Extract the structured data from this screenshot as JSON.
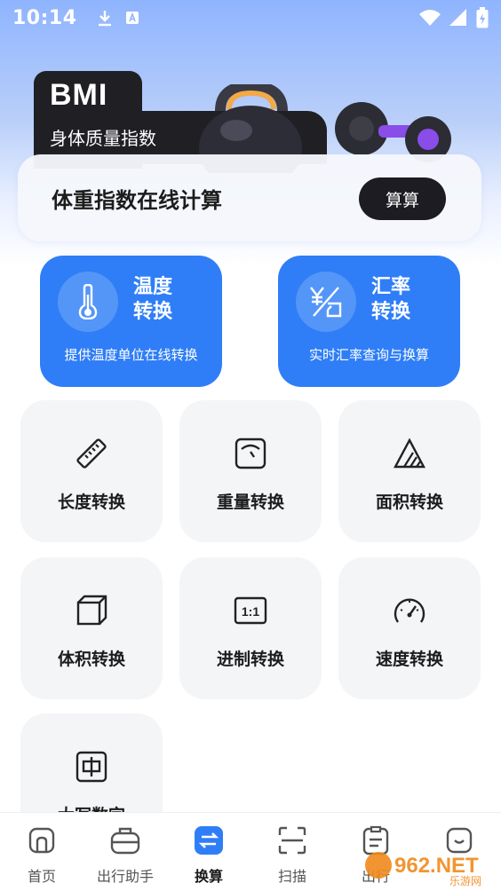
{
  "status_bar": {
    "time": "10:14"
  },
  "bmi": {
    "badge": "BMI",
    "subtitle": "身体质量指数",
    "panel_title": "体重指数在线计算",
    "calc_button": "算算"
  },
  "features": [
    {
      "title": "温度转换",
      "desc": "提供温度单位在线转换",
      "icon": "thermometer-icon"
    },
    {
      "title": "汇率转换",
      "desc": "实时汇率查询与换算",
      "icon": "currency-exchange-icon"
    }
  ],
  "tools": [
    {
      "label": "长度转换",
      "icon": "ruler-icon"
    },
    {
      "label": "重量转换",
      "icon": "scale-icon"
    },
    {
      "label": "面积转换",
      "icon": "area-icon"
    },
    {
      "label": "体积转换",
      "icon": "cube-icon"
    },
    {
      "label": "进制转换",
      "icon": "ratio-icon"
    },
    {
      "label": "速度转换",
      "icon": "speedometer-icon"
    },
    {
      "label": "大写数字",
      "icon": "chinese-numeral-icon"
    }
  ],
  "nav": [
    {
      "label": "首页",
      "icon": "home-icon"
    },
    {
      "label": "出行助手",
      "icon": "suitcase-icon"
    },
    {
      "label": "换算",
      "icon": "swap-icon"
    },
    {
      "label": "扫描",
      "icon": "scan-icon"
    },
    {
      "label": "出行",
      "icon": "clipboard-icon"
    },
    {
      "label": "",
      "icon": "profile-icon"
    }
  ],
  "watermark": "962.NET 乐游网",
  "colors": {
    "accent": "#2f7ef7",
    "dark": "#1f1f24",
    "tile_bg": "#f4f5f7"
  }
}
